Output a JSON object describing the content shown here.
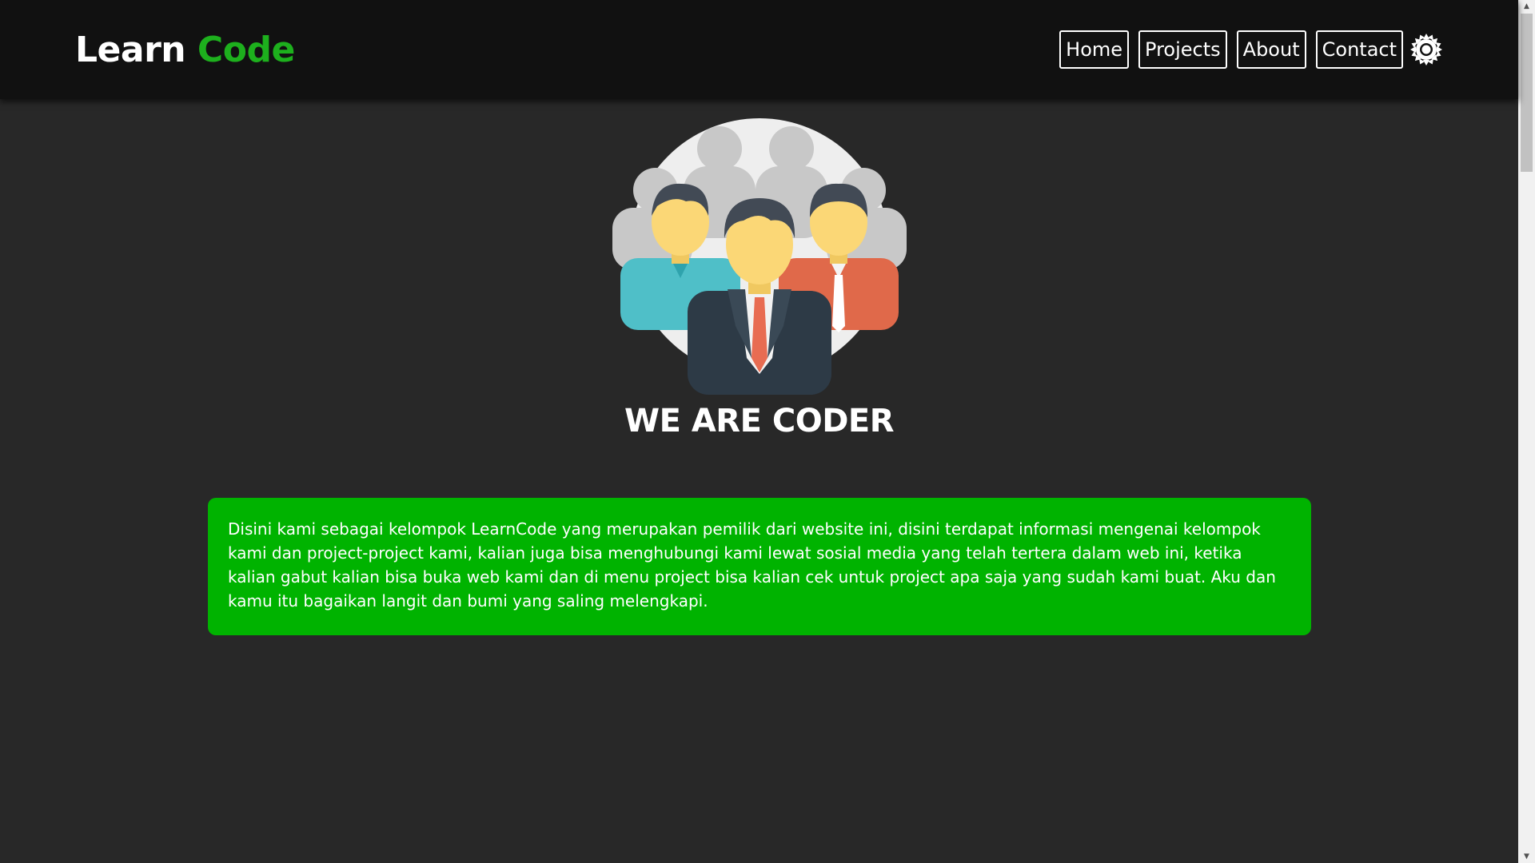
{
  "navbar": {
    "brand_part1": "Learn",
    "brand_part2": "Code",
    "links": [
      {
        "label": "Home"
      },
      {
        "label": "Projects"
      },
      {
        "label": "About"
      },
      {
        "label": "Contact"
      }
    ],
    "theme_icon": "sun-icon"
  },
  "hero": {
    "illustration": "team-group-icon",
    "title": "WE ARE CODER"
  },
  "info": {
    "text": "Disini kami sebagai kelompok LearnCode yang merupakan pemilik dari website ini, disini terdapat informasi mengenai kelompok kami dan project-project kami, kalian juga bisa menghubungi kami lewat sosial media yang telah tertera dalam web ini, ketika kalian gabut kalian bisa buka web kami dan di menu project bisa kalian cek untuk project apa saja yang sudah kami buat. Aku dan kamu itu bagaikan langit dan bumi yang saling melengkapi."
  },
  "colors": {
    "background": "#282828",
    "navbar": "#111111",
    "accent": "#1db01d",
    "info_box": "#00b300",
    "text": "#ffffff"
  }
}
